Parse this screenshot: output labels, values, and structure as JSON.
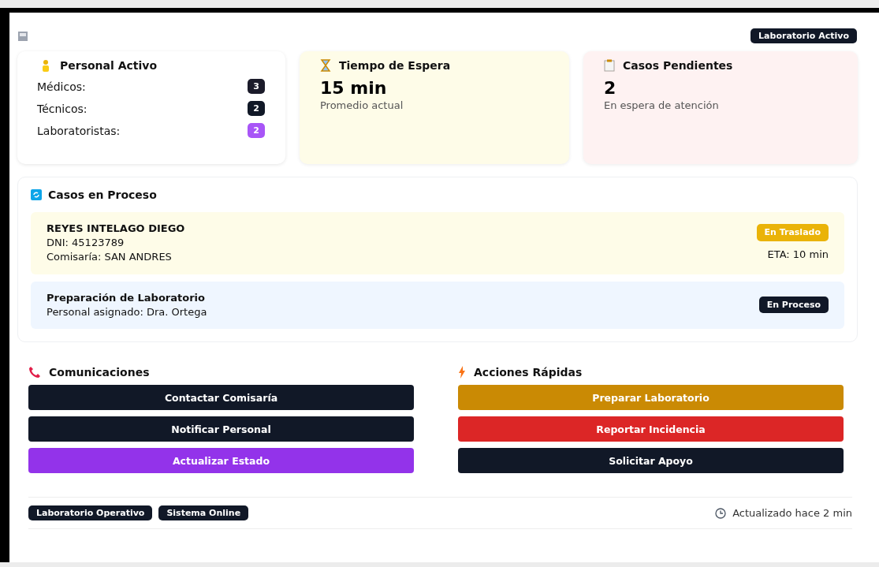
{
  "header": {
    "status_badge": "Laboratorio Activo"
  },
  "personal": {
    "title": "Personal Activo",
    "items": [
      {
        "label": "Médicos:",
        "count": "3",
        "color": "#1b1b2a"
      },
      {
        "label": "Técnicos:",
        "count": "2",
        "color": "#111827"
      },
      {
        "label": "Laboratoristas:",
        "count": "2",
        "color": "#a855f7"
      }
    ]
  },
  "stats": [
    {
      "kind": "wait",
      "title": "Tiempo de Espera",
      "value": "15 min",
      "caption": "Promedio actual"
    },
    {
      "kind": "pending",
      "title": "Casos Pendientes",
      "value": "2",
      "caption": "En espera de atención"
    }
  ],
  "cases": {
    "title": "Casos en Proceso",
    "items": [
      {
        "kind": "transfer",
        "lines": [
          "REYES INTELAGO DIEGO",
          "DNI: 45123789",
          "Comisaría: SAN ANDRES"
        ],
        "status": "En Traslado",
        "eta": "ETA: 10 min"
      },
      {
        "kind": "process",
        "lines": [
          "Preparación de Laboratorio",
          "Personal asignado: Dra. Ortega"
        ],
        "status": "En Proceso"
      }
    ]
  },
  "panels": [
    {
      "kind": "phone",
      "title": "Comunicaciones",
      "buttons": [
        {
          "label": "Contactar Comisaría",
          "color": "#111827"
        },
        {
          "label": "Notificar Personal",
          "color": "#111827"
        },
        {
          "label": "Actualizar Estado",
          "color": "#9333ea"
        }
      ]
    },
    {
      "kind": "bolt",
      "title": "Acciones Rápidas",
      "buttons": [
        {
          "label": "Preparar Laboratorio",
          "color": "#ca8a04"
        },
        {
          "label": "Reportar Incidencia",
          "color": "#dc2626"
        },
        {
          "label": "Solicitar Apoyo",
          "color": "#111827"
        }
      ]
    }
  ],
  "footer": {
    "badges": [
      "Laboratorio Operativo",
      "Sistema Online"
    ],
    "updated": "Actualizado hace 2 min"
  }
}
